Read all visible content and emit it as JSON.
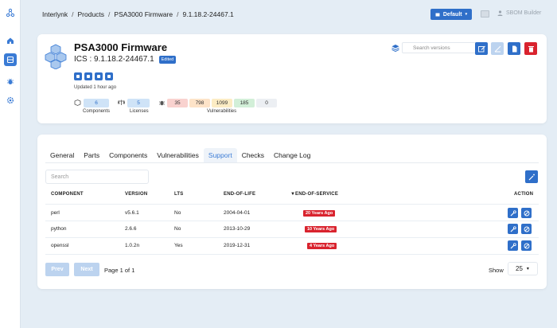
{
  "breadcrumb": [
    "Interlynk",
    "Products",
    "PSA3000 Firmware",
    "9.1.18.2-24467.1"
  ],
  "breadcrumb_sep": "/",
  "header": {
    "default_label": "Default",
    "user_label": "SBOM Builder"
  },
  "product": {
    "name": "PSA3000 Firmware",
    "version": "ICS : 9.1.18.2-24467.1",
    "edited_badge": "Edited",
    "updated": "Updated 1 hour ago",
    "search_versions_placeholder": "Search versions"
  },
  "stats": {
    "components": {
      "value": "6",
      "label": "Components"
    },
    "licenses": {
      "value": "5",
      "label": "Licenses"
    },
    "vulnerabilities": {
      "label": "Vulnerabilities",
      "counts": [
        "35",
        "798",
        "1099",
        "185",
        "0"
      ],
      "colors": [
        "#f9d2cf",
        "#fde3c8",
        "#fcecc4",
        "#d2efd8",
        "#eceff3"
      ]
    }
  },
  "tabs": [
    "General",
    "Parts",
    "Components",
    "Vulnerabilities",
    "Support",
    "Checks",
    "Change Log"
  ],
  "active_tab": "Support",
  "search_placeholder": "Search",
  "table": {
    "headers": {
      "component": "COMPONENT",
      "version": "VERSION",
      "lts": "LTS",
      "eol": "END-OF-LIFE",
      "eos": "END-OF-SERVICE",
      "action": "ACTION"
    },
    "rows": [
      {
        "component": "perl",
        "version": "v5.6.1",
        "lts": "No",
        "eol": "2004-04-01",
        "eos": "20 Years Ago"
      },
      {
        "component": "python",
        "version": "2.6.6",
        "lts": "No",
        "eol": "2013-10-29",
        "eos": "10 Years Ago"
      },
      {
        "component": "openssl",
        "version": "1.0.2n",
        "lts": "Yes",
        "eol": "2019-12-31",
        "eos": "4 Years Ago"
      }
    ]
  },
  "pagination": {
    "prev": "Prev",
    "next": "Next",
    "page_info": "Page 1 of 1",
    "show_label": "Show",
    "page_size": "25"
  },
  "colors": {
    "accent": "#2f6fc9",
    "danger": "#d9232e",
    "muted_button": "#bcd3ef"
  }
}
